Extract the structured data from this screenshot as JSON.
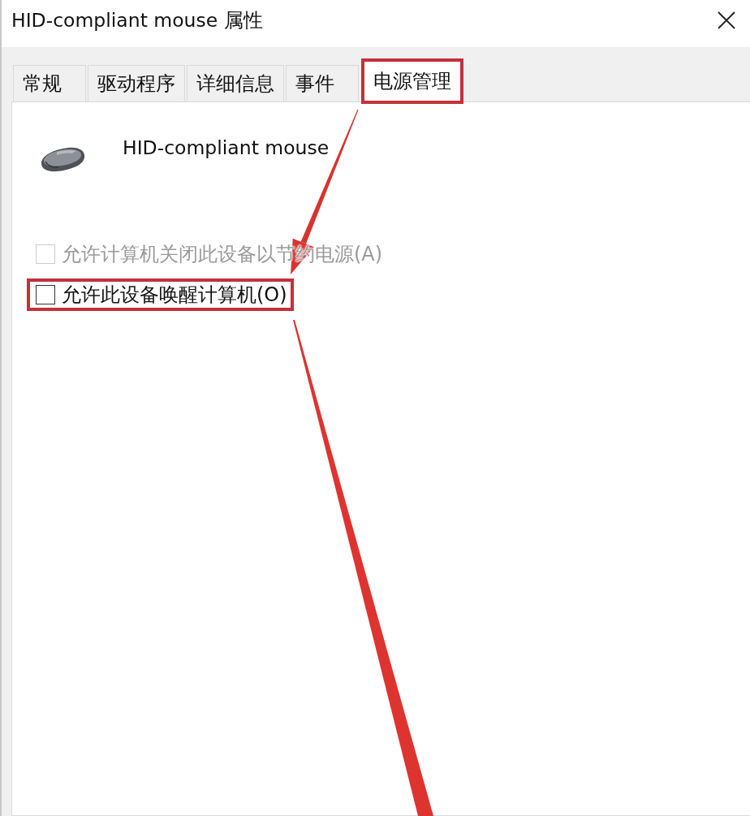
{
  "window": {
    "title": "HID-compliant mouse 属性"
  },
  "tabs": [
    {
      "label": "常规",
      "selected": false,
      "highlighted": false
    },
    {
      "label": "驱动程序",
      "selected": false,
      "highlighted": false
    },
    {
      "label": "详细信息",
      "selected": false,
      "highlighted": false
    },
    {
      "label": "事件",
      "selected": false,
      "highlighted": false
    },
    {
      "label": "电源管理",
      "selected": true,
      "highlighted": true
    }
  ],
  "device": {
    "name": "HID-compliant mouse"
  },
  "options": [
    {
      "label": "允许计算机关闭此设备以节约电源(A)",
      "checked": false,
      "disabled": true,
      "highlighted": false
    },
    {
      "label": "允许此设备唤醒计算机(O)",
      "checked": false,
      "disabled": false,
      "highlighted": true
    }
  ]
}
